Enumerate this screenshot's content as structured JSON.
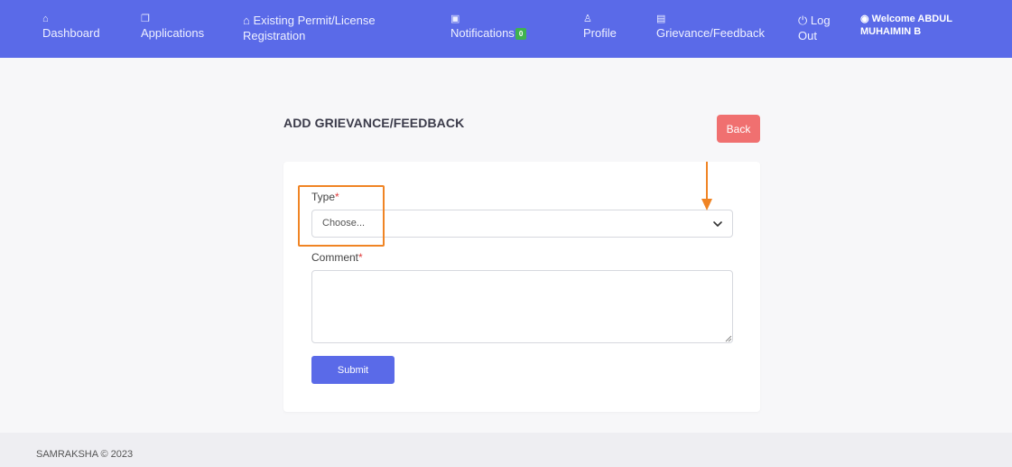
{
  "nav": {
    "items": [
      {
        "icon": "home-icon",
        "glyph": "⌂",
        "label": "Dashboard"
      },
      {
        "icon": "copy-icon",
        "glyph": "❐",
        "label": "Applications"
      },
      {
        "icon": "home-icon",
        "glyph": "⌂",
        "label_line1": "Existing Permit/License",
        "label_line2": "Registration"
      },
      {
        "icon": "calendar-icon",
        "glyph": "▣",
        "label": "Notifications",
        "badge": "0"
      },
      {
        "icon": "user-icon",
        "glyph": "♙",
        "label": "Profile"
      },
      {
        "icon": "file-icon",
        "glyph": "▤",
        "label": "Grievance/Feedback"
      },
      {
        "icon": "power-icon",
        "glyph": "⏻",
        "label_line1": "Log",
        "label_line2": "Out"
      }
    ],
    "welcome": {
      "icon": "user-circle-icon",
      "glyph": "◉",
      "line1": "Welcome ABDUL",
      "line2": "MUHAIMIN B"
    }
  },
  "page": {
    "title": "ADD GRIEVANCE/FEEDBACK",
    "back_label": "Back"
  },
  "form": {
    "type_label": "Type",
    "type_value": "Choose...",
    "comment_label": "Comment",
    "comment_value": "",
    "required_mark": "*",
    "submit_label": "Submit"
  },
  "footer": {
    "text": "SAMRAKSHA © 2023"
  },
  "colors": {
    "nav_bg": "#5a6ae8",
    "back_button": "#f07070",
    "submit_button": "#5a6ae8",
    "annotation": "#f08424",
    "badge": "#3fb34f"
  }
}
